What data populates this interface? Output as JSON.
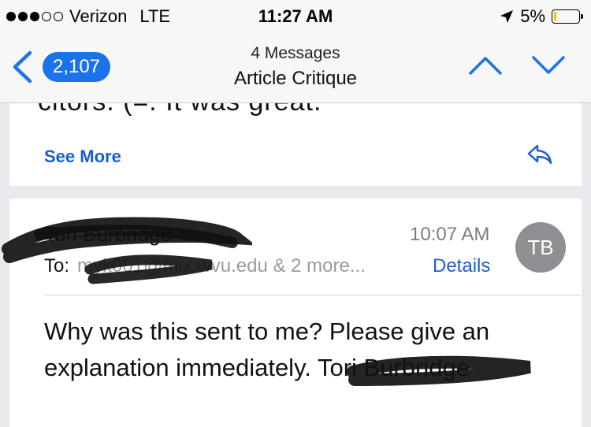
{
  "status_bar": {
    "signal_dots_filled": 3,
    "signal_dots_total": 5,
    "carrier": "Verizon",
    "network": "LTE",
    "time": "11:27 AM",
    "battery_percent": "5%",
    "battery_level": 0.05,
    "battery_color": "#f2c300"
  },
  "nav": {
    "unread_count": "2,107",
    "subtitle": "4 Messages",
    "title": "Article Critique",
    "accent": "#1a73e8"
  },
  "previous_message": {
    "cut_text": "citors. (=. It was great.",
    "see_more_label": "See More",
    "reply_icon": "reply-arrow-icon"
  },
  "message": {
    "sender": "Tori Burbridge",
    "time": "10:07 AM",
    "avatar_initials": "TB",
    "to_label": "To:",
    "recipients": "myk001@mix.wvu.edu & 2 more...",
    "details_label": "Details",
    "body": "Why was this sent to me? Please give an explanation immediately.",
    "signature": "Tori Burbridge"
  }
}
